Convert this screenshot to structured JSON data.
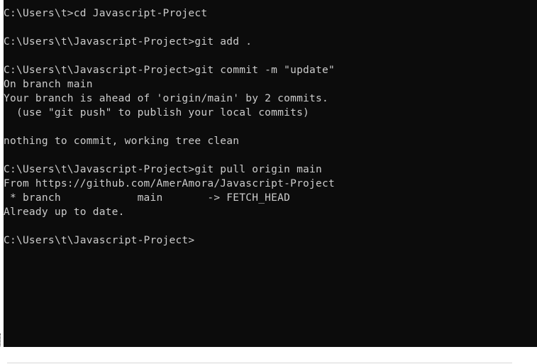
{
  "terminal": {
    "lines": [
      "C:\\Users\\t>cd Javascript-Project",
      "",
      "C:\\Users\\t\\Javascript-Project>git add .",
      "",
      "C:\\Users\\t\\Javascript-Project>git commit -m \"update\"",
      "On branch main",
      "Your branch is ahead of 'origin/main' by 2 commits.",
      "  (use \"git push\" to publish your local commits)",
      "",
      "nothing to commit, working tree clean",
      "",
      "C:\\Users\\t\\Javascript-Project>git pull origin main",
      "From https://github.com/AmerAmora/Javascript-Project",
      " * branch            main       -> FETCH_HEAD",
      "Already up to date.",
      "",
      "C:\\Users\\t\\Javascript-Project>"
    ]
  },
  "colors": {
    "terminal_background": "#0c0c0c",
    "terminal_text": "#cccccc",
    "page_background": "#ffffff"
  }
}
